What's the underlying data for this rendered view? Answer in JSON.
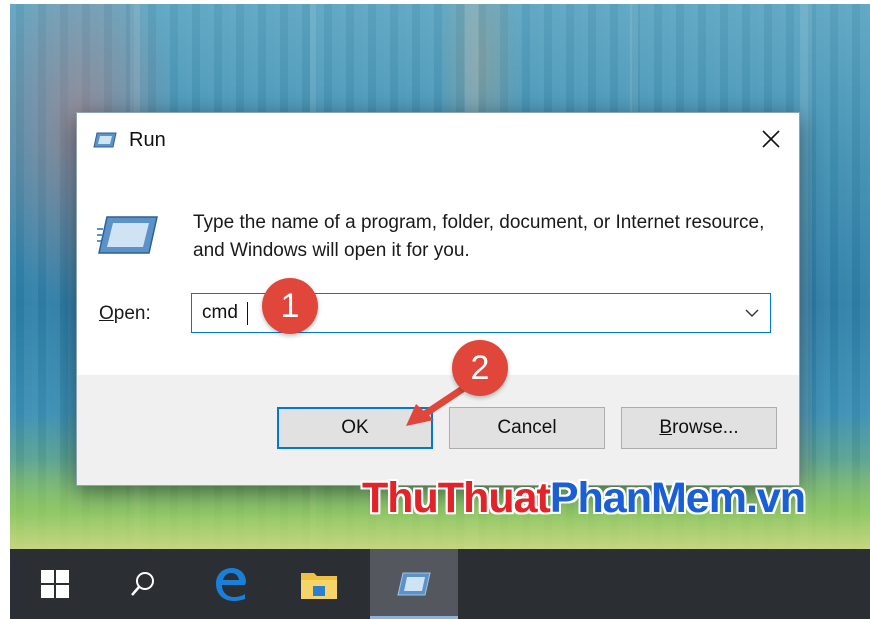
{
  "dialog": {
    "title": "Run",
    "description": "Type the name of a program, folder, document, or Internet resource, and Windows will open it for you.",
    "open_label_accel": "O",
    "open_label_rest": "pen:",
    "open_value": "cmd",
    "buttons": {
      "ok": "OK",
      "cancel": "Cancel",
      "browse_accel": "B",
      "browse_rest": "rowse..."
    }
  },
  "annotations": {
    "step1": "1",
    "step2": "2"
  },
  "watermark": {
    "part_a": "ThuThuat",
    "part_b": "PhanMem.vn"
  },
  "taskbar": {
    "items": [
      "windows-start",
      "search",
      "edge",
      "file-explorer",
      "run"
    ]
  },
  "colors": {
    "accent": "#0078d7",
    "badge": "#e0463a",
    "taskbar": "#2b2e33",
    "watermark_red": "#e3232a",
    "watermark_blue": "#1a5fd6"
  }
}
